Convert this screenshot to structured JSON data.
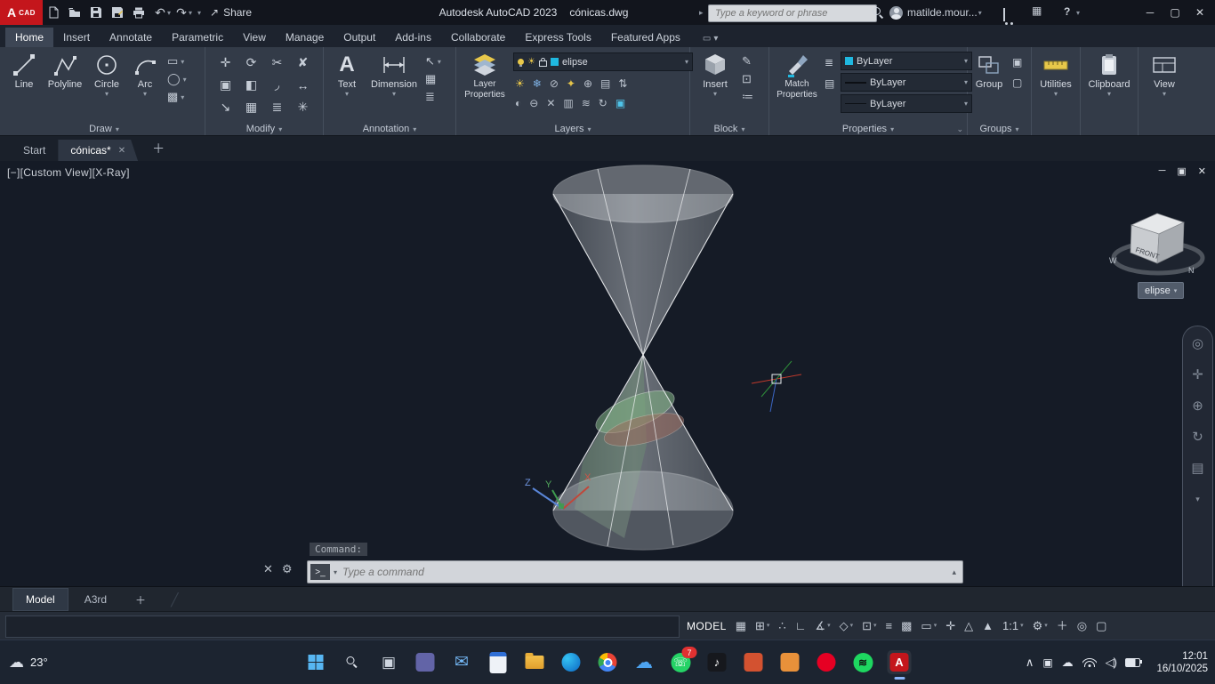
{
  "colors": {
    "autocad_red": "#c4161c",
    "bylayer_cyan": "#1fb8e0",
    "viewport_bg": "#151b26",
    "ribbon_bg": "#333b48",
    "section_green": "#7fae83",
    "section_brown": "#a06a5c"
  },
  "titlebar": {
    "logo_a": "A",
    "logo_cad": "CAD",
    "share": "Share",
    "app_title": "Autodesk AutoCAD 2023",
    "doc_title": "cónicas.dwg",
    "search_placeholder": "Type a keyword or phrase",
    "user": "matilde.mour...",
    "help": "?"
  },
  "ribbon": {
    "tabs": [
      "Home",
      "Insert",
      "Annotate",
      "Parametric",
      "View",
      "Manage",
      "Output",
      "Add-ins",
      "Collaborate",
      "Express Tools",
      "Featured Apps"
    ],
    "draw": {
      "label": "Draw",
      "line": "Line",
      "polyline": "Polyline",
      "circle": "Circle",
      "arc": "Arc"
    },
    "modify": {
      "label": "Modify"
    },
    "annotation": {
      "label": "Annotation",
      "text": "Text",
      "text_icon": "A",
      "dimension": "Dimension"
    },
    "layers": {
      "label": "Layers",
      "layer_properties": "Layer Properties",
      "current_layer": "elipse"
    },
    "block": {
      "label": "Block",
      "insert": "Insert"
    },
    "properties": {
      "label": "Properties",
      "match": "Match Properties",
      "color": "ByLayer",
      "lineweight": "ByLayer",
      "linetype": "ByLayer"
    },
    "groups": {
      "label": "Groups",
      "group": "Group"
    },
    "utilities": {
      "label": "Utilities"
    },
    "clipboard": {
      "label": "Clipboard"
    },
    "view": {
      "label": "View"
    }
  },
  "file_tabs": {
    "start": "Start",
    "document": "cónicas*"
  },
  "viewport": {
    "view_controls": "[−][Custom View][X-Ray]",
    "viewcube_front": "FRONT",
    "compass_w": "W",
    "compass_n": "N",
    "layer_badge": "elipse",
    "ucs_x": "X",
    "ucs_y": "Y",
    "ucs_z": "Z",
    "command_ghost": "Command:",
    "command_placeholder": "Type a command"
  },
  "model_bar": {
    "model": "Model",
    "layout2": "A3rd"
  },
  "status_bar": {
    "model": "MODEL",
    "scale": "1:1"
  },
  "taskbar": {
    "temperature": "23°",
    "whatsapp_badge": "7",
    "autocad_letter": "A",
    "time": "12:01",
    "date": "16/10/2025"
  }
}
